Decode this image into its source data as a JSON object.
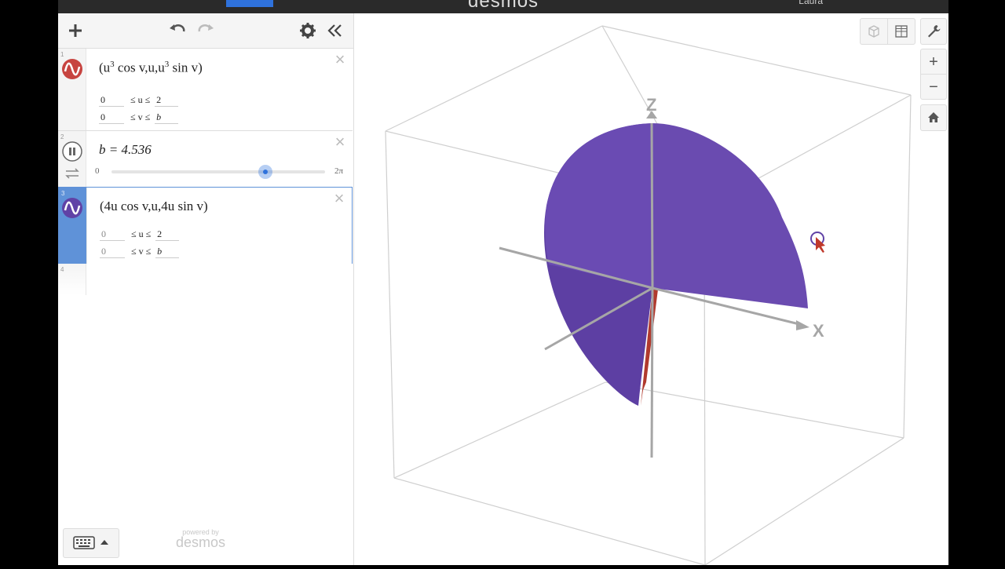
{
  "app": {
    "logo": "desmos",
    "user_name": "Laura"
  },
  "toolbar": {
    "add_icon": "plus-icon",
    "undo_icon": "undo-icon",
    "redo_icon": "redo-icon",
    "settings_icon": "gear-icon",
    "collapse_icon": "double-chevron-left-icon"
  },
  "expressions": [
    {
      "number": "1",
      "formula_lead": "(u",
      "exp1": "3",
      "formula_mid": " cos v,u,u",
      "exp2": "3",
      "formula_tail": " sin v)",
      "u_min": "0",
      "u_label": "≤ u ≤",
      "u_max": "2",
      "v_min": "0",
      "v_label": "≤ v ≤",
      "v_max": "b",
      "color": "#c74440"
    },
    {
      "number": "2",
      "formula": "b = 4.536",
      "slider_min": "0",
      "slider_max": "2π",
      "slider_value": 4.536,
      "slider_range_max": 6.2832
    },
    {
      "number": "3",
      "formula": "(4u cos v,u,4u sin v)",
      "u_min": "0",
      "u_label": "≤ u ≤",
      "u_max": "2",
      "v_min": "0",
      "v_label": "≤ v ≤",
      "v_max": "b",
      "color": "#6042a6"
    },
    {
      "number": "4"
    }
  ],
  "footer": {
    "powered_by": "powered by",
    "brand": "desmos",
    "keyboard_icon": "keyboard-icon"
  },
  "graph": {
    "axis_x": "X",
    "axis_z": "Z",
    "surface_color": "#6a4bb0",
    "surface2_color": "#c0392b",
    "zoom_in_label": "+",
    "zoom_out_label": "−",
    "tools": [
      "cube-icon",
      "grid-icon",
      "wrench-icon",
      "home-icon"
    ]
  }
}
